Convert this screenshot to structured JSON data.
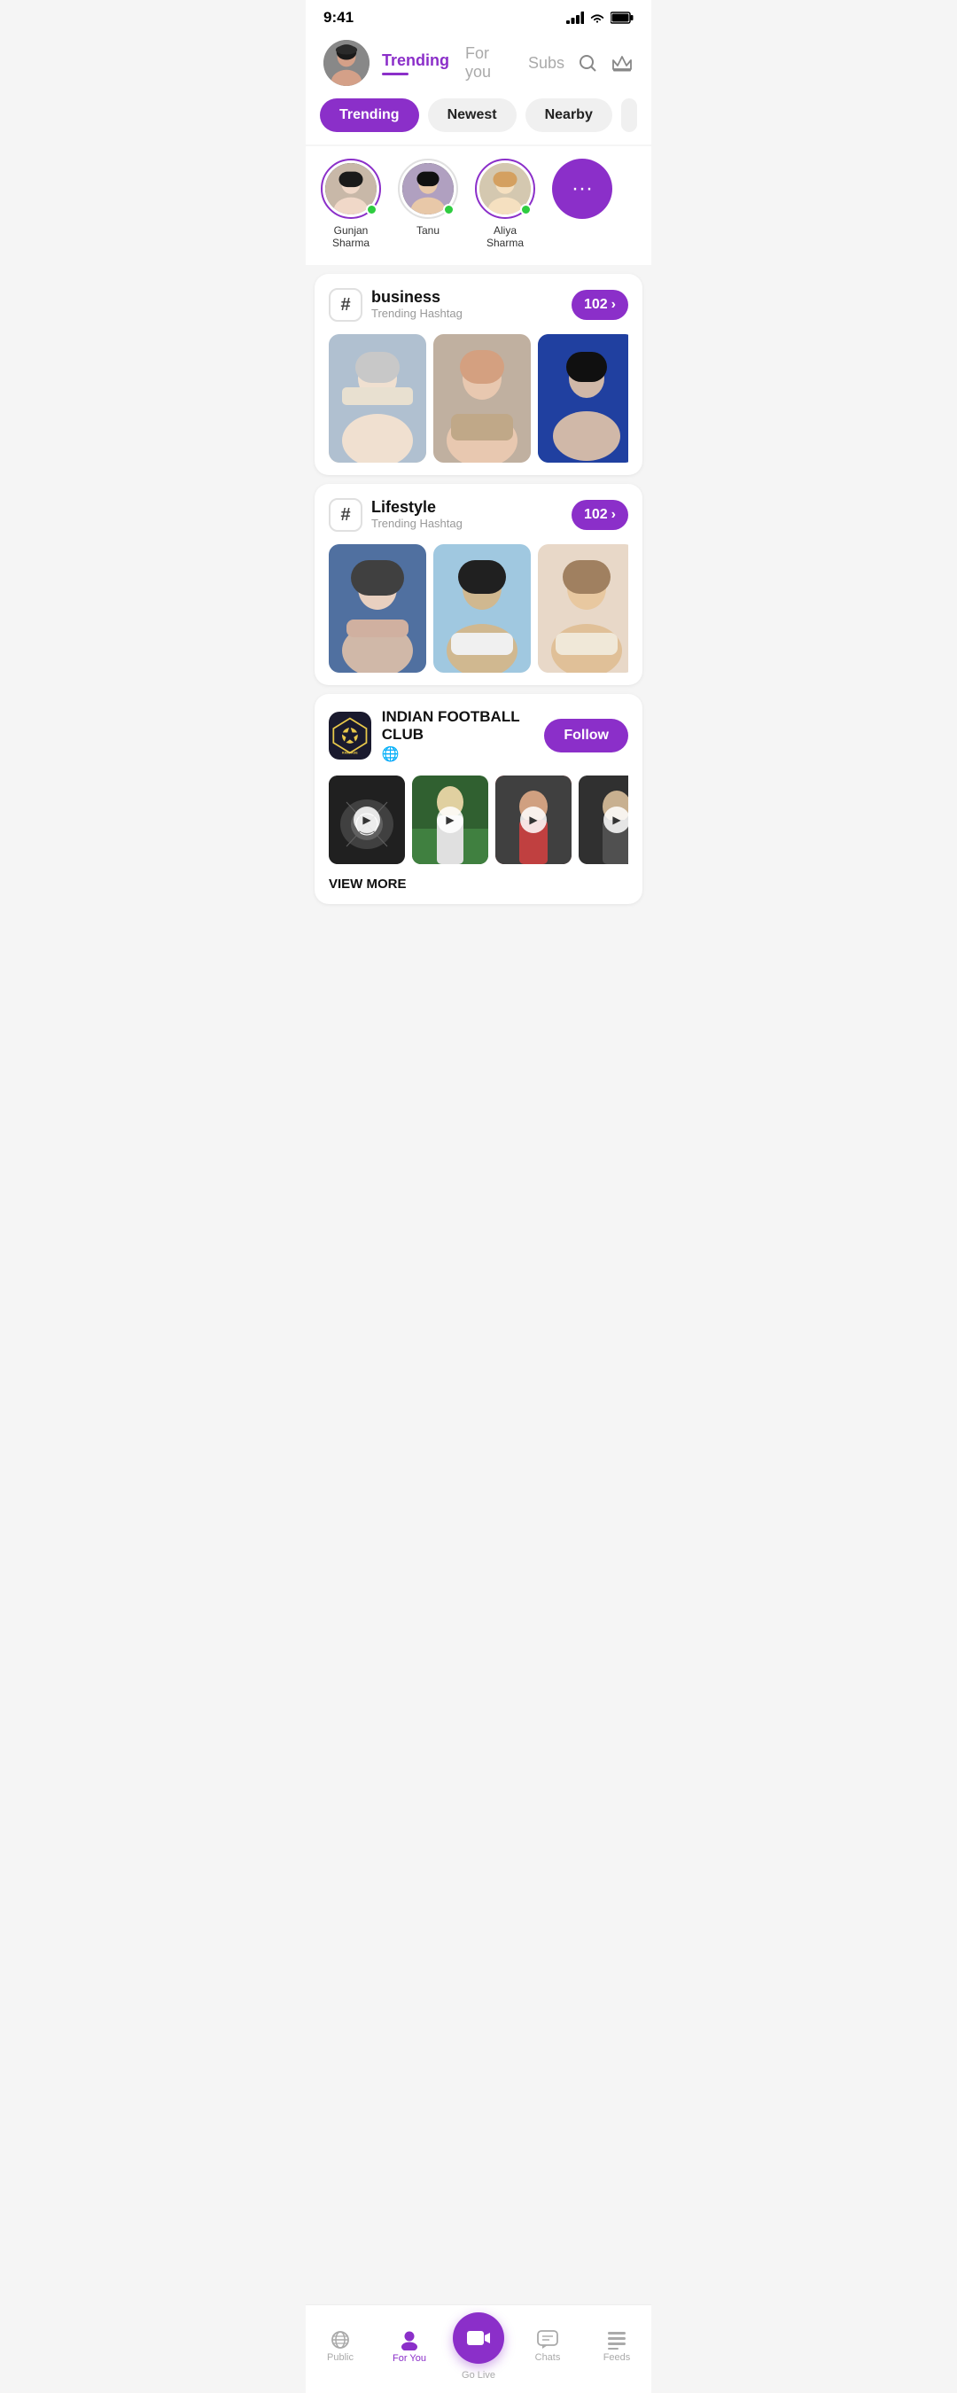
{
  "statusBar": {
    "time": "9:41",
    "signal": "▂▄▆█",
    "wifi": "wifi",
    "battery": "battery"
  },
  "header": {
    "tabs": [
      {
        "id": "trending",
        "label": "Trending",
        "active": true
      },
      {
        "id": "for-you",
        "label": "For you",
        "active": false
      },
      {
        "id": "subs",
        "label": "Subs",
        "active": false
      }
    ],
    "searchLabel": "search",
    "crownLabel": "crown"
  },
  "filterBar": {
    "buttons": [
      {
        "label": "Trending",
        "active": true
      },
      {
        "label": "Newest",
        "active": false
      },
      {
        "label": "Nearby",
        "active": false
      }
    ]
  },
  "stories": {
    "items": [
      {
        "name": "Gunjan Sharma",
        "online": true,
        "ring": true
      },
      {
        "name": "Tanu",
        "online": true,
        "ring": false
      },
      {
        "name": "Aliya Sharma",
        "online": true,
        "ring": true
      }
    ],
    "moreLabel": "···"
  },
  "sections": [
    {
      "type": "hashtag",
      "tag": "business",
      "sub": "Trending Hashtag",
      "count": "102",
      "images": [
        "t1",
        "t2",
        "t3"
      ]
    },
    {
      "type": "hashtag",
      "tag": "Lifestyle",
      "sub": "Trending Hashtag",
      "count": "102",
      "images": [
        "t4",
        "t5",
        "t6"
      ]
    },
    {
      "type": "club",
      "logoText": "WINDY city",
      "name": "INDIAN FOOTBALL CLUB",
      "globe": "🌐",
      "followLabel": "Follow",
      "videos": [
        "t7",
        "t8",
        "t9",
        "t10"
      ],
      "viewMore": "VIEW MORE"
    }
  ],
  "bottomNav": {
    "items": [
      {
        "id": "public",
        "icon": "📡",
        "label": "Public",
        "active": false
      },
      {
        "id": "for-you",
        "icon": "👤",
        "label": "For You",
        "active": true
      },
      {
        "id": "go-live",
        "icon": "🎥",
        "label": "Go Live",
        "active": false,
        "isCenter": true
      },
      {
        "id": "chats",
        "icon": "💬",
        "label": "Chats",
        "active": false
      },
      {
        "id": "feeds",
        "icon": "≡",
        "label": "Feeds",
        "active": false
      }
    ]
  }
}
